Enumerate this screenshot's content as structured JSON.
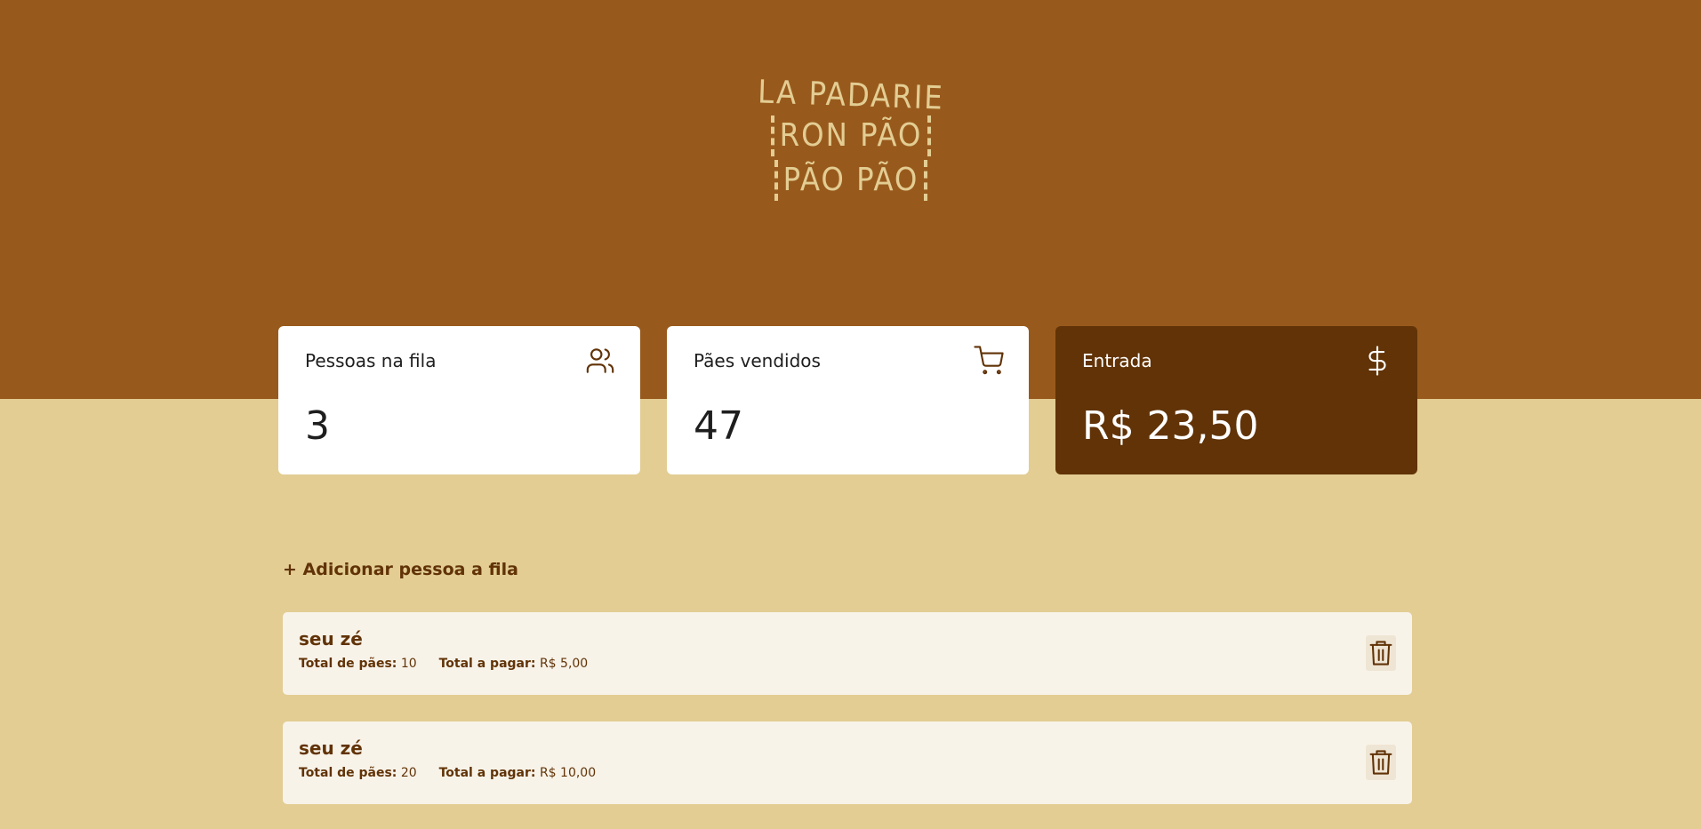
{
  "logo": {
    "line1": "LA PADARIE",
    "line2": "RON PÃO",
    "line3": "PÃO PÃO"
  },
  "cards": [
    {
      "label": "Pessoas na fila",
      "value": "3",
      "icon": "users-icon"
    },
    {
      "label": "Pães vendidos",
      "value": "47",
      "icon": "cart-icon"
    },
    {
      "label": "Entrada",
      "value": "R$ 23,50",
      "icon": "dollar-icon"
    }
  ],
  "add_label": "+ Adicionar pessoa a fila",
  "queue": [
    {
      "name": "seu zé",
      "breads_label": "Total de pães:",
      "breads": "10",
      "pay_label": "Total a pagar:",
      "pay": "R$ 5,00"
    },
    {
      "name": "seu zé",
      "breads_label": "Total de pães:",
      "breads": "20",
      "pay_label": "Total a pagar:",
      "pay": "R$ 10,00"
    }
  ],
  "colors": {
    "header": "#985a1c",
    "background": "#e3cd93",
    "dark_brown": "#613307",
    "card_light": "#ffffff",
    "item_bg": "#f8f3e9"
  }
}
